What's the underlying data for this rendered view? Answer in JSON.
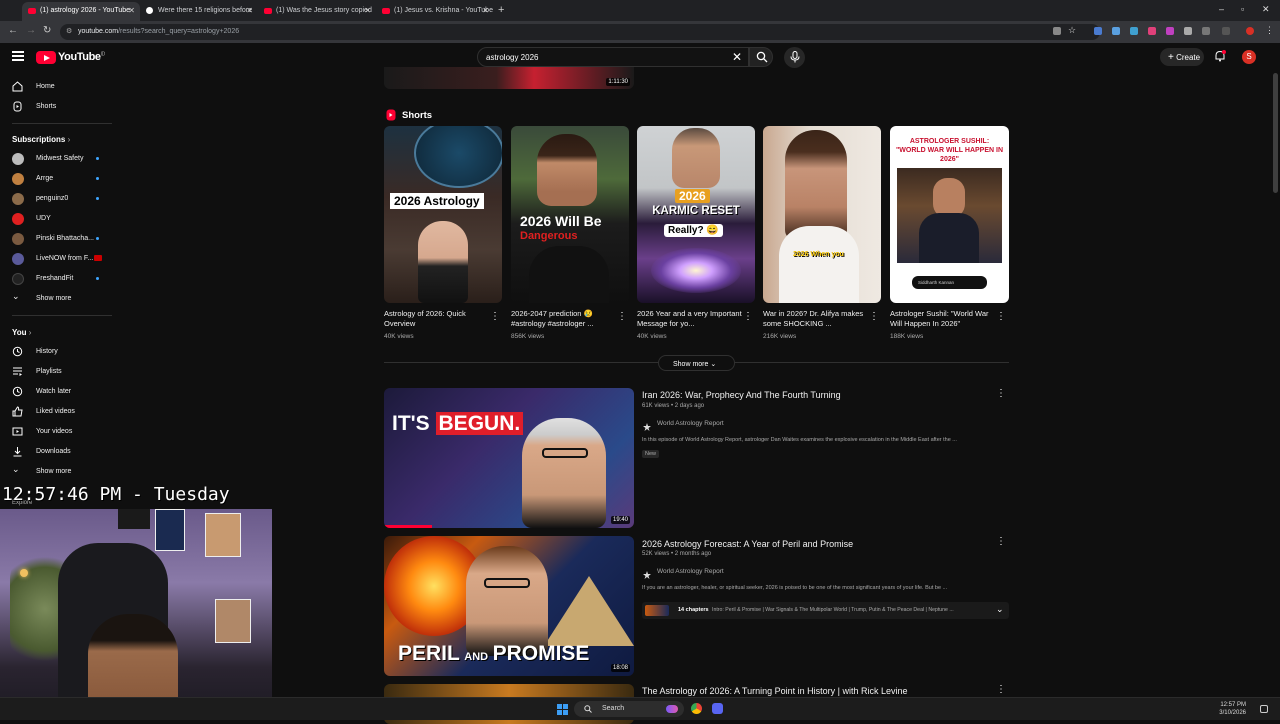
{
  "browser": {
    "tabs": [
      {
        "title": "(1) astrology 2026 - YouTube",
        "active": true,
        "icon": "youtube-icon"
      },
      {
        "title": "Were there 15 religions before",
        "active": false,
        "icon": "google-icon"
      },
      {
        "title": "(1) Was the Jesus story copied",
        "active": false,
        "icon": "youtube-icon"
      },
      {
        "title": "(1) Jesus vs. Krishna - YouTube",
        "active": false,
        "icon": "youtube-icon"
      }
    ],
    "url_host": "youtube.com",
    "url_path": "/results?search_query=astrology+2026"
  },
  "header": {
    "logo_text": "YouTube",
    "logo_country": "ID",
    "search_value": "astrology 2026",
    "create_label": "Create",
    "avatar_letter": "S"
  },
  "sidebar": {
    "main": [
      {
        "label": "Home",
        "icon": "home-icon"
      },
      {
        "label": "Shorts",
        "icon": "shorts-icon"
      }
    ],
    "subs_heading": "Subscriptions",
    "subscriptions": [
      {
        "label": "Midwest Safety",
        "color": "#bcbcbc",
        "dot": true
      },
      {
        "label": "Arrge",
        "color": "#c08040",
        "dot": true
      },
      {
        "label": "penguinz0",
        "color": "#8b6b4a",
        "dot": true
      },
      {
        "label": "UDY",
        "color": "#e02020",
        "dot": false
      },
      {
        "label": "Pinski Bhattacha...",
        "color": "#7a5a40",
        "dot": true
      },
      {
        "label": "LiveNOW from F...",
        "color": "#5a5a9a",
        "dot": false
      },
      {
        "label": "FreshandFit",
        "color": "#222222",
        "dot": true
      }
    ],
    "subs_more": "Show more",
    "you_heading": "You",
    "you_items": [
      {
        "label": "History",
        "icon": "history-icon"
      },
      {
        "label": "Playlists",
        "icon": "playlists-icon"
      },
      {
        "label": "Watch later",
        "icon": "clock-icon"
      },
      {
        "label": "Liked videos",
        "icon": "thumbs-up-icon"
      },
      {
        "label": "Your videos",
        "icon": "your-videos-icon"
      },
      {
        "label": "Downloads",
        "icon": "download-icon"
      }
    ],
    "you_more": "Show more",
    "explore": "Explore"
  },
  "main": {
    "top_duration": "1:11:30",
    "shorts_heading": "Shorts",
    "shorts": [
      {
        "title": "Astrology of 2026: Quick Overview",
        "views": "40K views",
        "overlay": "2026 Astrology"
      },
      {
        "title": "2026-2047 prediction 😢 #astrology #astrologer ...",
        "views": "856K views",
        "overlay": "2026 Will Be",
        "overlay2": "Dangerous"
      },
      {
        "title": "2026 Year and a very Important Message for yo...",
        "views": "40K views",
        "overlay": "2026",
        "overlay2": "KARMIC RESET",
        "overlay3": "Really? 😄"
      },
      {
        "title": "War in 2026?  Dr. Alifya makes some SHOCKING ...",
        "views": "216K views",
        "overlay": "2026 When you"
      },
      {
        "title": "Astrologer Sushil: \"World War Will Happen In 2026\"",
        "views": "188K views",
        "overlay": "ASTROLOGER SUSHIL: \"WORLD WAR WILL HAPPEN IN 2026\"",
        "overlay2": "Siddharth Kannan"
      }
    ],
    "show_more": "Show more",
    "videos": [
      {
        "title": "Iran 2026: War, Prophecy And The Fourth Turning",
        "meta": "61K views • 2 days ago",
        "channel": "World Astrology Report",
        "desc": "In this episode of World Astrology Report, astrologer Dan Waites examines the explosive escalation in the Middle East after the ...",
        "badge": "New",
        "duration": "19:40",
        "thumb_text1": "IT'S",
        "thumb_text2": "BEGUN."
      },
      {
        "title": "2026 Astrology Forecast: A Year of Peril and Promise",
        "meta": "52K views • 2 months ago",
        "channel": "World Astrology Report",
        "desc": "If you are an astrologer, healer, or spiritual seeker, 2026 is poised to be one of the most significant years of your life. But be ...",
        "chapters_count": "14 chapters",
        "chapters": "Intro: Peril & Promise | War Signals & The Multipolar World | Trump, Putin & The Peace Deal | Neptune ...",
        "duration": "18:08",
        "thumb_text1": "PERIL",
        "thumb_text_and": "AND",
        "thumb_text2": "PROMISE"
      },
      {
        "title": "The Astrology of 2026: A Turning Point in History | with Rick Levine"
      }
    ]
  },
  "overlay": {
    "clock": "12:57:46 PM - Tuesday"
  },
  "taskbar": {
    "search": "Search",
    "time": "12:57 PM",
    "date": "3/10/2026"
  },
  "colors": {
    "bg": "#0f0f0f",
    "brand": "#ff0033",
    "accent": "#3ea6ff"
  }
}
